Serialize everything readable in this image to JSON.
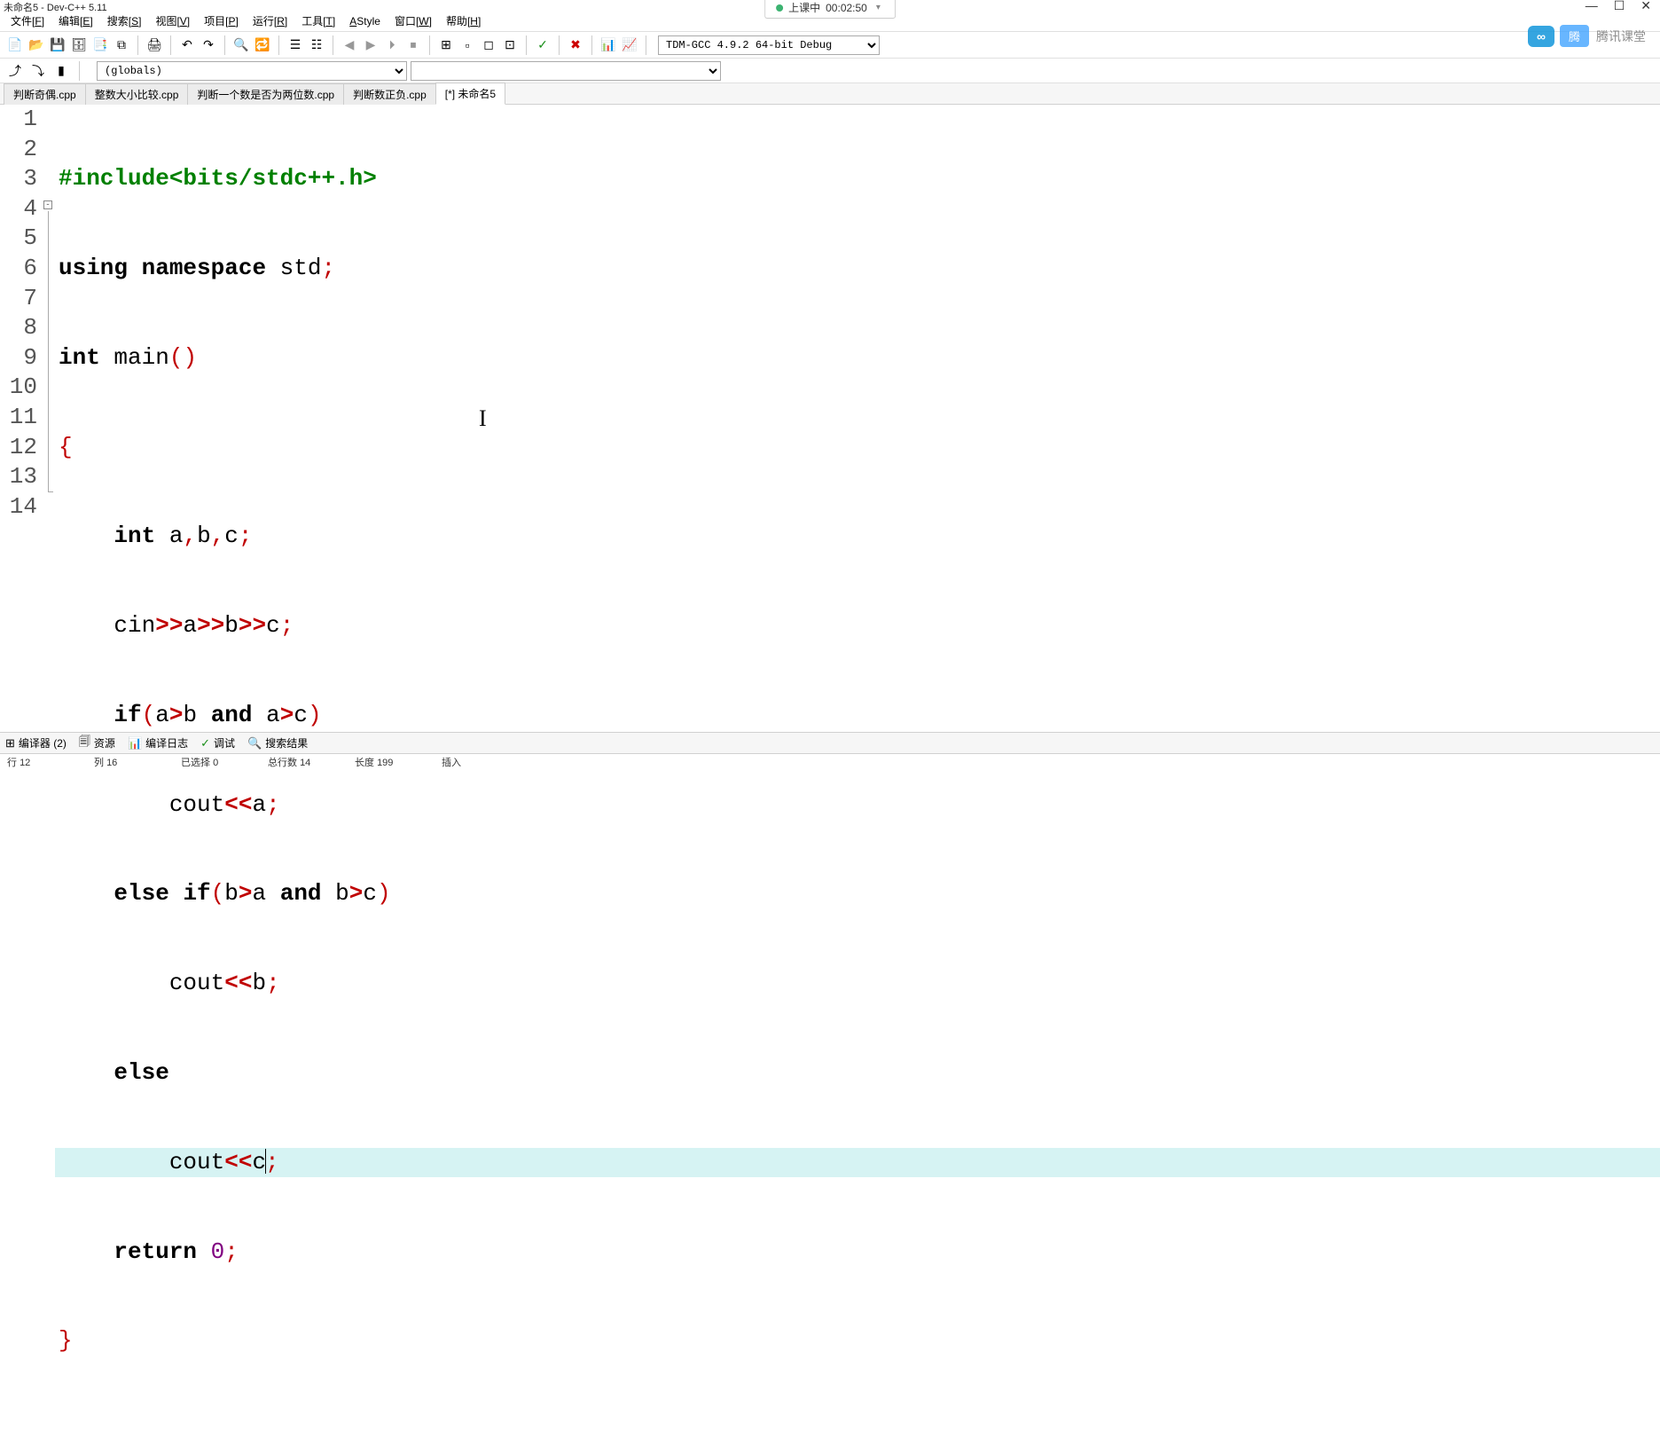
{
  "title": "未命名5 - Dev-C++ 5.11",
  "recording": {
    "label": "上课中",
    "time": "00:02:50"
  },
  "win_controls": {
    "min": "—",
    "max": "☐",
    "close": "✕"
  },
  "menu": [
    {
      "label": "文件",
      "key": "F"
    },
    {
      "label": "编辑",
      "key": "E"
    },
    {
      "label": "搜索",
      "key": "S"
    },
    {
      "label": "视图",
      "key": "V"
    },
    {
      "label": "项目",
      "key": "P"
    },
    {
      "label": "运行",
      "key": "R"
    },
    {
      "label": "工具",
      "key": "T"
    },
    {
      "label": "AStyle",
      "key": ""
    },
    {
      "label": "窗口",
      "key": "W"
    },
    {
      "label": "帮助",
      "key": "H"
    }
  ],
  "compiler_select": "TDM-GCC 4.9.2 64-bit Debug",
  "scope_select": "(globals)",
  "tabs": [
    {
      "label": "判断奇偶.cpp",
      "active": false
    },
    {
      "label": "整数大小比较.cpp",
      "active": false
    },
    {
      "label": "判断一个数是否为两位数.cpp",
      "active": false
    },
    {
      "label": "判断数正负.cpp",
      "active": false
    },
    {
      "label": "[*] 未命名5",
      "active": true
    }
  ],
  "code": {
    "l1_a": "#include",
    "l1_b": "<bits/stdc++.h>",
    "l2_a": "using",
    "l2_b": "namespace",
    "l2_c": "std",
    "l3_a": "int",
    "l3_b": "main",
    "l5_a": "int",
    "l5_b": "a",
    "l5_c": "b",
    "l5_d": "c",
    "l6_a": "cin",
    "l6_b": "a",
    "l6_c": "b",
    "l6_d": "c",
    "l7_a": "if",
    "l7_b": "a",
    "l7_c": "b",
    "l7_d": "and",
    "l7_e": "a",
    "l7_f": "c",
    "l8_a": "cout",
    "l8_b": "a",
    "l9_a": "else",
    "l9_b": "if",
    "l9_c": "b",
    "l9_d": "a",
    "l9_e": "and",
    "l9_f": "b",
    "l9_g": "c",
    "l10_a": "cout",
    "l10_b": "b",
    "l11_a": "else",
    "l12_a": "cout",
    "l12_b": "c",
    "l13_a": "return",
    "l13_b": "0"
  },
  "line_numbers": [
    "1",
    "2",
    "3",
    "4",
    "5",
    "6",
    "7",
    "8",
    "9",
    "10",
    "11",
    "12",
    "13",
    "14"
  ],
  "bottom_tabs": [
    {
      "icon": "⊞",
      "label": "编译器 (2)"
    },
    {
      "icon": "🗐",
      "label": "资源"
    },
    {
      "icon": "📊",
      "label": "编译日志"
    },
    {
      "icon": "✓",
      "label": "调试"
    },
    {
      "icon": "🔍",
      "label": "搜索结果"
    }
  ],
  "status": {
    "line_lbl": "行",
    "line_val": "12",
    "col_lbl": "列",
    "col_val": "16",
    "sel_lbl": "已选择",
    "sel_val": "0",
    "total_lbl": "总行数",
    "total_val": "14",
    "len_lbl": "长度",
    "len_val": "199",
    "ins": "插入"
  },
  "watermark": {
    "brand": "腾讯课堂"
  }
}
